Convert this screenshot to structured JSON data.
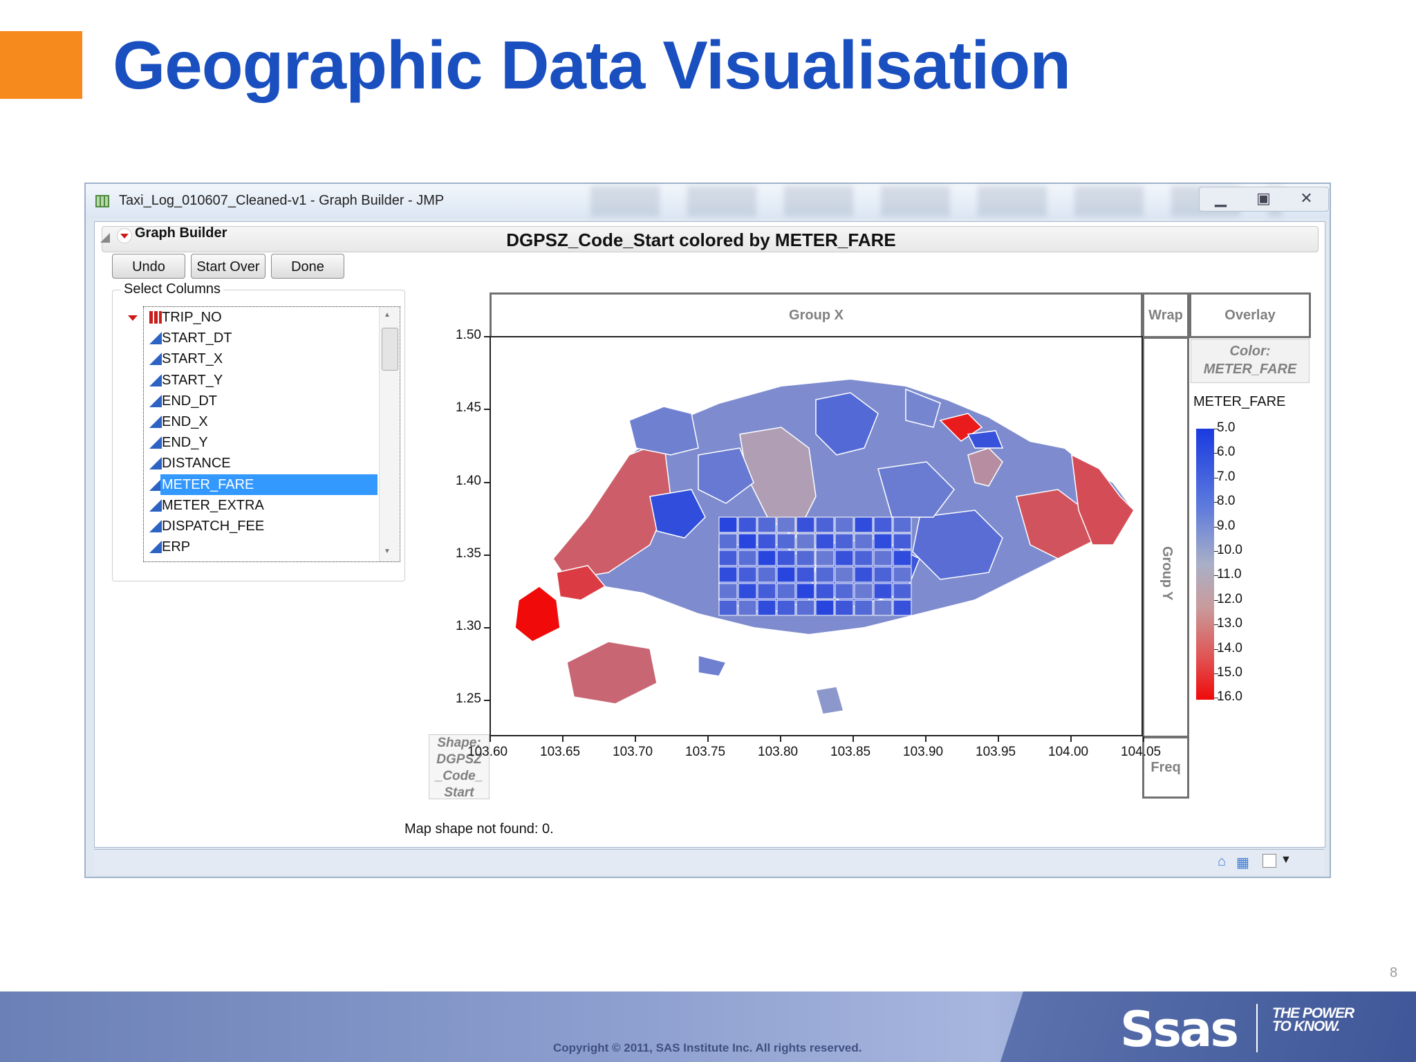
{
  "slide": {
    "title": "Geographic Data Visualisation",
    "page_number": "8",
    "copyright": "Copyright © 2011, SAS Institute Inc. All rights reserved.",
    "logo_text": "Ssas",
    "tagline": "THE POWER TO KNOW."
  },
  "window": {
    "title": "Taxi_Log_010607_Cleaned-v1 - Graph Builder - JMP",
    "controls": [
      "minimize-icon",
      "restore-icon",
      "close-icon"
    ]
  },
  "graph_builder": {
    "header": "Graph Builder",
    "buttons": {
      "undo": "Undo",
      "start_over": "Start Over",
      "done": "Done"
    },
    "select_columns_label": "Select Columns",
    "columns": [
      {
        "name": "TRIP_NO",
        "type": "nominal"
      },
      {
        "name": "START_DT",
        "type": "continuous"
      },
      {
        "name": "START_X",
        "type": "continuous"
      },
      {
        "name": "START_Y",
        "type": "continuous"
      },
      {
        "name": "END_DT",
        "type": "continuous"
      },
      {
        "name": "END_X",
        "type": "continuous"
      },
      {
        "name": "END_Y",
        "type": "continuous"
      },
      {
        "name": "DISTANCE",
        "type": "continuous"
      },
      {
        "name": "METER_FARE",
        "type": "continuous",
        "selected": true
      },
      {
        "name": "METER_EXTRA",
        "type": "continuous"
      },
      {
        "name": "DISPATCH_FEE",
        "type": "continuous"
      },
      {
        "name": "ERP",
        "type": "continuous"
      }
    ],
    "zones": {
      "group_x": "Group X",
      "wrap": "Wrap",
      "overlay": "Overlay",
      "color_label": "Color:",
      "color_field": "METER_FARE",
      "group_y": "Group Y",
      "freq": "Freq",
      "shape_label": "Shape:",
      "shape_field": "DGPSZ _Code_ Start"
    },
    "status": "Map shape not found: 0."
  },
  "chart_data": {
    "type": "map",
    "title": "DGPSZ_Code_Start colored by METER_FARE",
    "xticks": [
      "103.60",
      "103.65",
      "103.70",
      "103.75",
      "103.80",
      "103.85",
      "103.90",
      "103.95",
      "104.00",
      "104.05"
    ],
    "yticks": [
      "1.50",
      "1.45",
      "1.40",
      "1.35",
      "1.30",
      "1.25"
    ],
    "xlim": [
      103.6,
      104.05
    ],
    "ylim": [
      1.225,
      1.5
    ],
    "color_variable": "METER_FARE",
    "legend": {
      "title": "METER_FARE",
      "ticks": [
        "5.0",
        "6.0",
        "7.0",
        "8.0",
        "9.0",
        "10.0",
        "11.0",
        "12.0",
        "13.0",
        "14.0",
        "15.0",
        "16.0"
      ],
      "low_color": "#1a3ae0",
      "mid_color": "#a9afc7",
      "high_color": "#f00a0a"
    }
  }
}
